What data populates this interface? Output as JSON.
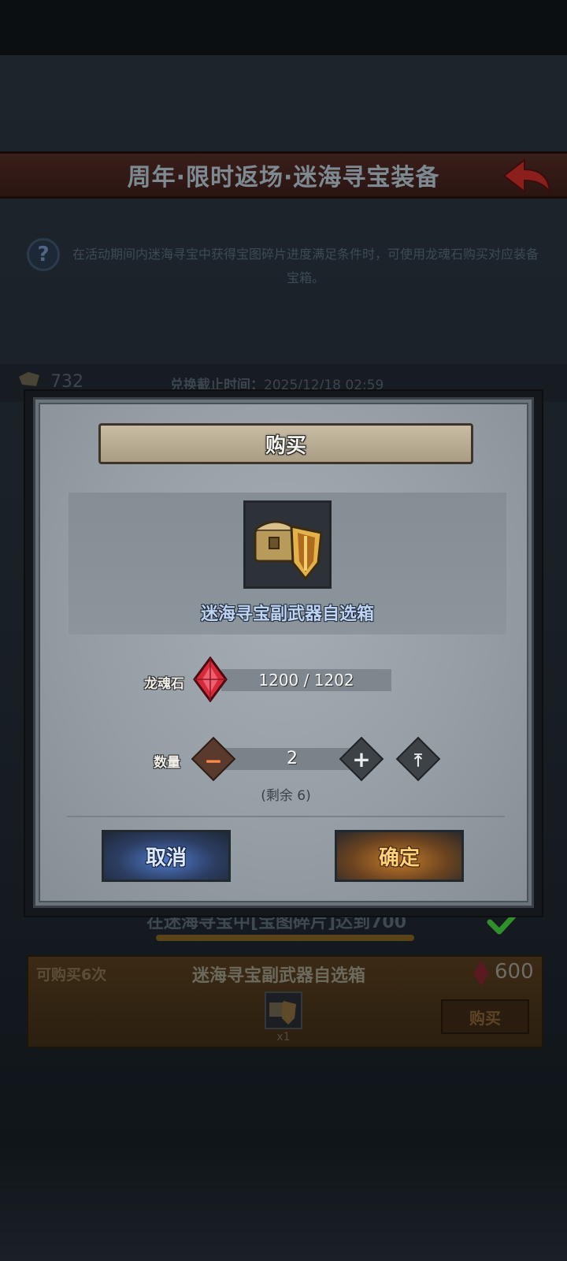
{
  "header": {
    "title": "周年·限时返场·迷海寻宝装备"
  },
  "info": {
    "help_glyph": "?",
    "text": "在活动期间内迷海寻宝中获得宝图碎片进度满足条件时，可使用龙魂石购买对应装备宝箱。"
  },
  "stats": {
    "value": "732",
    "deadline_label": "兑换截止时间：",
    "deadline_value": "2025/12/18 02:59"
  },
  "condition": {
    "text": "在迷海寻宝中[宝图碎片]达到700",
    "completed": true
  },
  "card": {
    "limit": "可购买6次",
    "name": "迷海寻宝副武器自选箱",
    "price": "600",
    "item_qty": "x1",
    "buy_label": "购买"
  },
  "modal": {
    "title": "购买",
    "item_name": "迷海寻宝副武器自选箱",
    "currency_label": "龙魂石",
    "currency_value": "1200 / 1202",
    "quantity_label": "数量",
    "quantity": "2",
    "minus_glyph": "−",
    "plus_glyph": "+",
    "max_glyph": "⤒",
    "remaining": "(剩余 6)",
    "cancel_label": "取消",
    "confirm_label": "确定"
  },
  "icons": [
    "back-arrow-icon",
    "help-icon",
    "map-fragment-icon",
    "check-icon",
    "red-gem-icon",
    "chest-shield-icon",
    "minus-icon",
    "plus-icon",
    "max-icon"
  ],
  "colors": {
    "accent_blue": "#4e79c9",
    "accent_orange": "#c27a2a",
    "gem_red": "#d62a3a",
    "check_green": "#2f8f2a"
  }
}
